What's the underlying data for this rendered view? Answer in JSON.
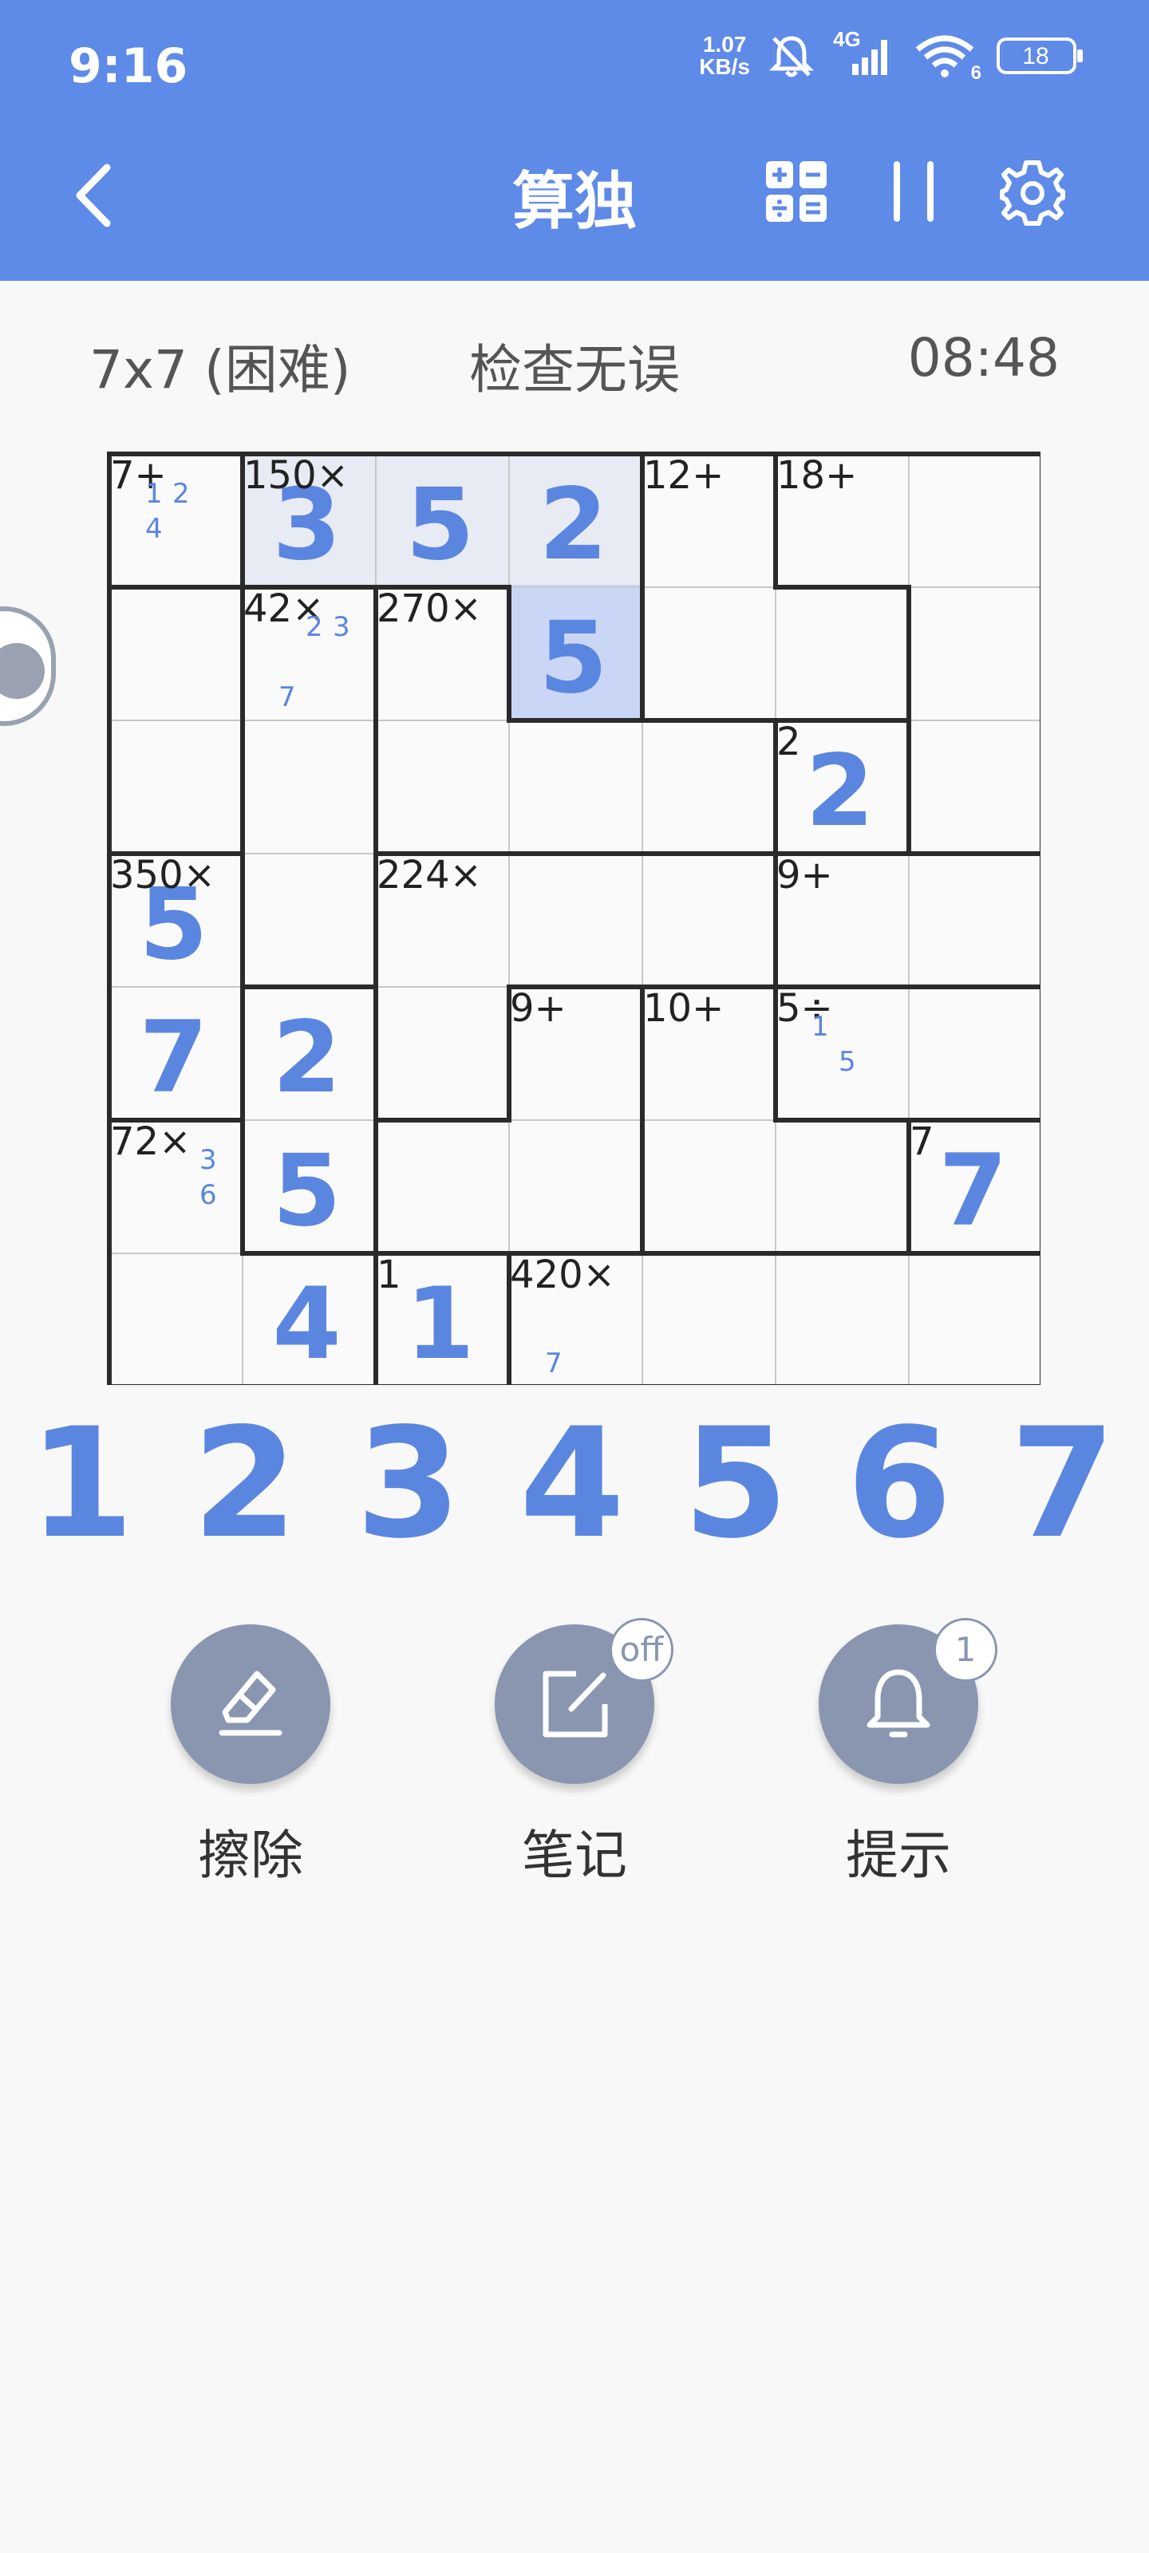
{
  "status_bar": {
    "time": "9:16",
    "net_speed_value": "1.07",
    "net_speed_unit": "KB/s",
    "signal_label": "4G",
    "wifi_label": "6",
    "battery": "18"
  },
  "header": {
    "title": "算独"
  },
  "info": {
    "size": "7x7 (困难)",
    "status": "检查无误",
    "timer": "08:48"
  },
  "colors": {
    "accent": "#5e8ae8",
    "number": "#5b86e0",
    "highlight": "#e8ebf4",
    "selected": "#c9d6f6",
    "button": "#8a96b0"
  },
  "board": {
    "size": 7,
    "cells": [
      [
        "",
        "3",
        "5",
        "2",
        "",
        "",
        ""
      ],
      [
        "",
        "",
        "",
        "5",
        "",
        "",
        ""
      ],
      [
        "",
        "",
        "",
        "",
        "",
        "2",
        ""
      ],
      [
        "5",
        "",
        "",
        "",
        "",
        "",
        ""
      ],
      [
        "7",
        "2",
        "",
        "",
        "",
        "",
        ""
      ],
      [
        "",
        "5",
        "",
        "",
        "",
        "",
        "7"
      ],
      [
        "",
        "4",
        "1",
        "",
        "",
        "",
        ""
      ]
    ],
    "clues": [
      {
        "r": 0,
        "c": 0,
        "text": "7+"
      },
      {
        "r": 0,
        "c": 1,
        "text": "150×"
      },
      {
        "r": 0,
        "c": 4,
        "text": "12+"
      },
      {
        "r": 0,
        "c": 5,
        "text": "18+"
      },
      {
        "r": 1,
        "c": 1,
        "text": "42×"
      },
      {
        "r": 1,
        "c": 2,
        "text": "270×"
      },
      {
        "r": 2,
        "c": 5,
        "text": "2"
      },
      {
        "r": 3,
        "c": 0,
        "text": "350×"
      },
      {
        "r": 3,
        "c": 2,
        "text": "224×"
      },
      {
        "r": 3,
        "c": 5,
        "text": "9+"
      },
      {
        "r": 4,
        "c": 3,
        "text": "9+"
      },
      {
        "r": 4,
        "c": 4,
        "text": "10+"
      },
      {
        "r": 4,
        "c": 5,
        "text": "5÷"
      },
      {
        "r": 5,
        "c": 0,
        "text": "72×"
      },
      {
        "r": 5,
        "c": 6,
        "text": "7"
      },
      {
        "r": 6,
        "c": 2,
        "text": "1"
      },
      {
        "r": 6,
        "c": 3,
        "text": "420×"
      }
    ],
    "notes": [
      {
        "r": 0,
        "c": 0,
        "digits": [
          "1",
          "2",
          "4"
        ]
      },
      {
        "r": 1,
        "c": 1,
        "digits": [
          "2",
          "3",
          "7"
        ]
      },
      {
        "r": 4,
        "c": 5,
        "digits": [
          "1",
          "5"
        ]
      },
      {
        "r": 5,
        "c": 0,
        "digits": [
          "3",
          "6"
        ]
      },
      {
        "r": 6,
        "c": 3,
        "digits": [
          "7"
        ]
      }
    ],
    "highlighted": [
      [
        0,
        1
      ],
      [
        0,
        2
      ],
      [
        0,
        3
      ]
    ],
    "selected": [
      1,
      3
    ],
    "cages": [
      [
        [
          0,
          0
        ]
      ],
      [
        [
          0,
          1
        ],
        [
          0,
          2
        ],
        [
          0,
          3
        ],
        [
          1,
          3
        ]
      ],
      [
        [
          0,
          4
        ],
        [
          1,
          4
        ],
        [
          1,
          5
        ]
      ],
      [
        [
          0,
          5
        ],
        [
          0,
          6
        ],
        [
          1,
          6
        ],
        [
          2,
          6
        ]
      ],
      [
        [
          1,
          0
        ],
        [
          2,
          0
        ]
      ],
      [
        [
          1,
          1
        ],
        [
          2,
          1
        ],
        [
          3,
          1
        ]
      ],
      [
        [
          1,
          2
        ],
        [
          2,
          2
        ],
        [
          2,
          3
        ],
        [
          2,
          4
        ]
      ],
      [
        [
          2,
          5
        ]
      ],
      [
        [
          3,
          0
        ],
        [
          4,
          0
        ]
      ],
      [
        [
          3,
          2
        ],
        [
          3,
          3
        ],
        [
          3,
          4
        ],
        [
          4,
          2
        ]
      ],
      [
        [
          3,
          5
        ],
        [
          3,
          6
        ]
      ],
      [
        [
          4,
          1
        ],
        [
          5,
          1
        ]
      ],
      [
        [
          4,
          3
        ],
        [
          5,
          2
        ],
        [
          5,
          3
        ]
      ],
      [
        [
          4,
          4
        ],
        [
          5,
          4
        ],
        [
          5,
          5
        ]
      ],
      [
        [
          4,
          5
        ],
        [
          4,
          6
        ]
      ],
      [
        [
          5,
          0
        ],
        [
          6,
          0
        ],
        [
          6,
          1
        ]
      ],
      [
        [
          5,
          6
        ]
      ],
      [
        [
          6,
          2
        ]
      ],
      [
        [
          6,
          3
        ],
        [
          6,
          4
        ],
        [
          6,
          5
        ],
        [
          6,
          6
        ]
      ]
    ]
  },
  "numpad": [
    "1",
    "2",
    "3",
    "4",
    "5",
    "6",
    "7"
  ],
  "tools": {
    "erase": {
      "label": "擦除"
    },
    "note": {
      "label": "笔记",
      "badge": "off"
    },
    "hint": {
      "label": "提示",
      "badge": "1"
    }
  }
}
